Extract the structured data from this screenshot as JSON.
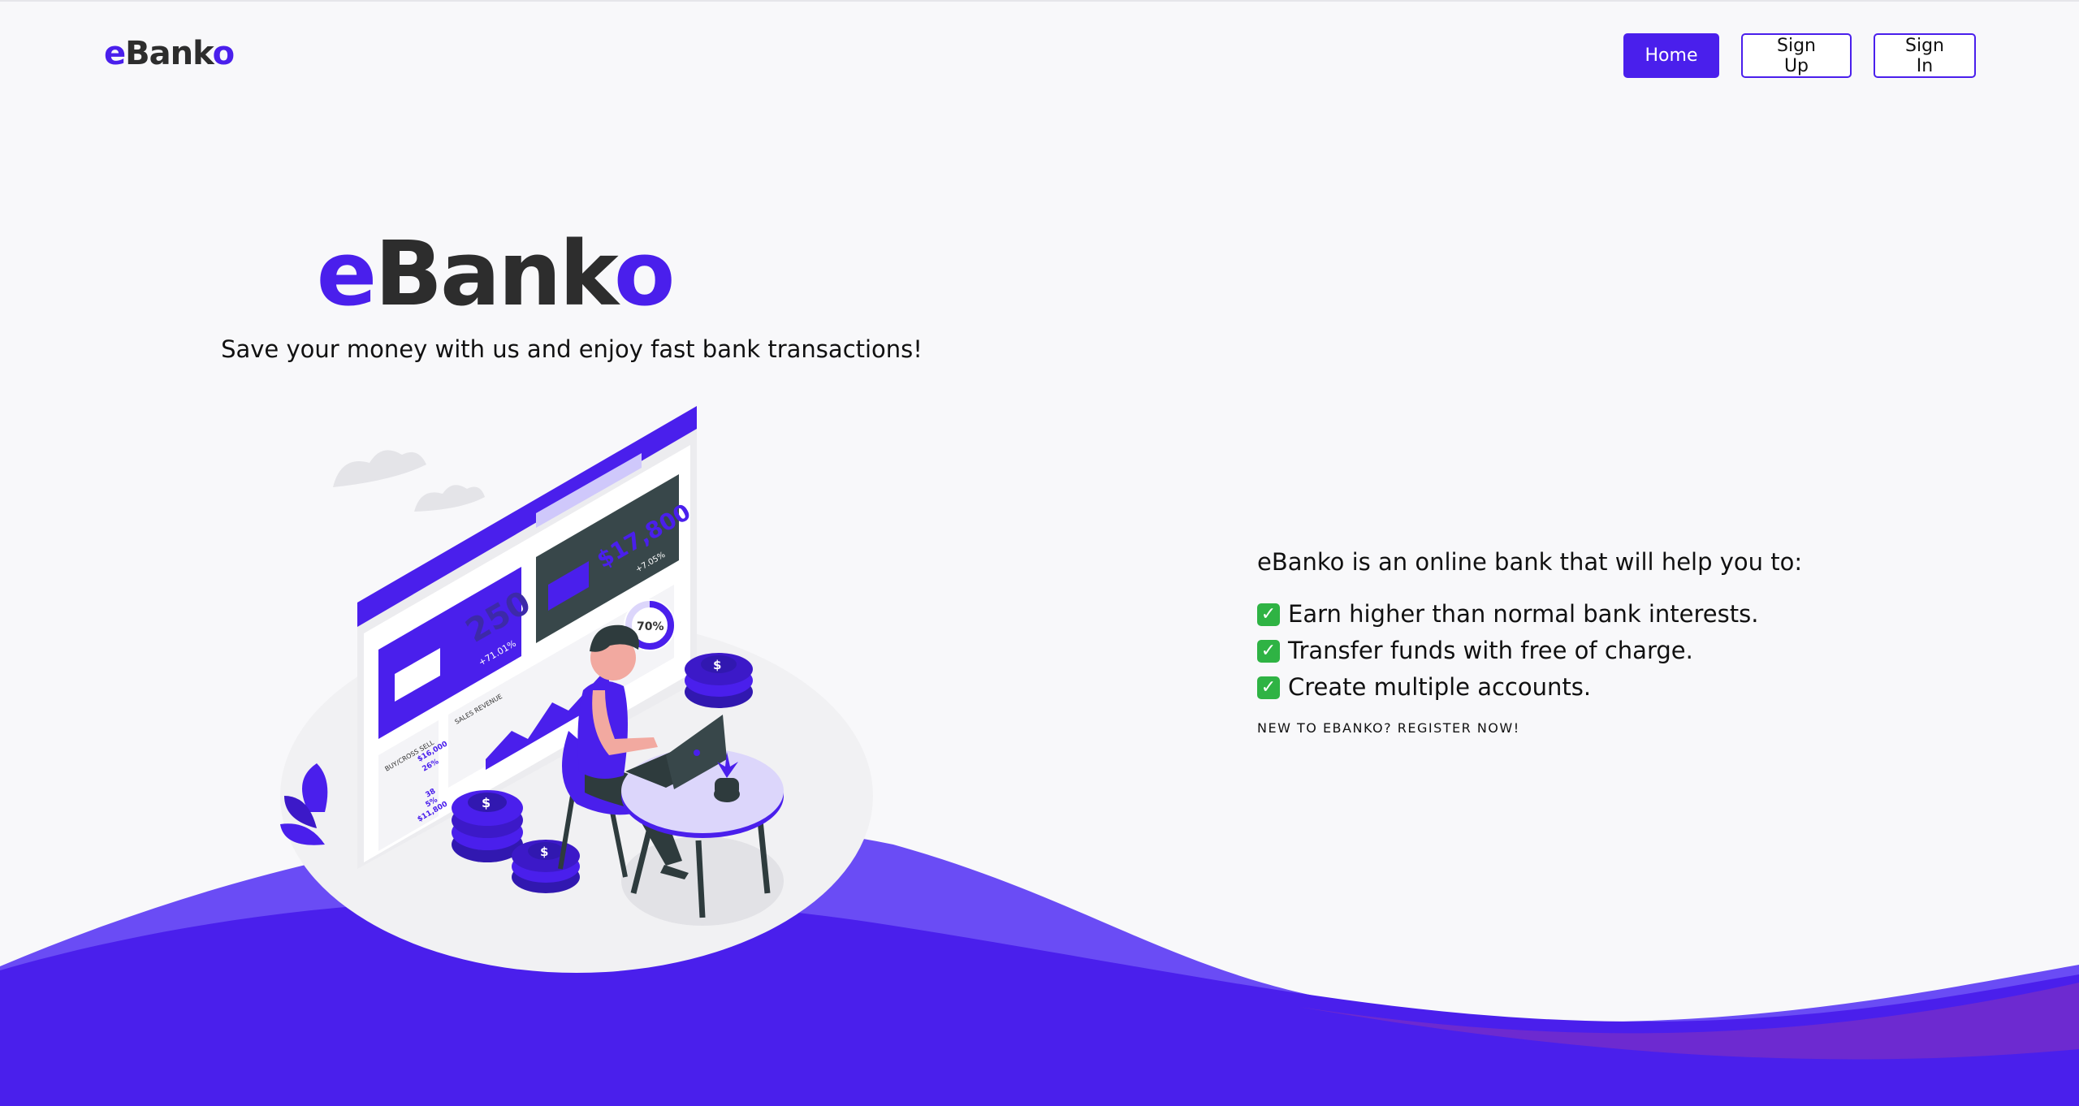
{
  "brand": {
    "prefix": "e",
    "middle": "Bank",
    "suffix": "o"
  },
  "nav": {
    "home_label": "Home",
    "signup_label": "Sign Up",
    "signin_label": "Sign In"
  },
  "hero": {
    "subtitle": "Save your money with us and enjoy fast bank transactions!"
  },
  "illustration": {
    "balance_value": "250",
    "balance_change": "+71.01%",
    "total_value": "$17,800",
    "total_change": "+7.05%",
    "progress_label": "70%",
    "progress": 0.7,
    "sales_label": "SALES REVENUE",
    "buy_sell_label": "BUY/CROSS SELL",
    "stat_value_1": "$16,000",
    "stat_value_2": "26%",
    "stat_value_3": "38",
    "stat_value_4": "5%",
    "stat_value_5": "$11,800",
    "coin_symbol": "$"
  },
  "info": {
    "lead": "eBanko is an online bank that will help you to:",
    "features": [
      "Earn higher than normal bank interests.",
      "Transfer funds with free of charge.",
      "Create multiple accounts."
    ],
    "check_icon": "✓",
    "register_label": "NEW TO EBANKO? REGISTER NOW!"
  },
  "colors": {
    "accent": "#4a1fec",
    "accent_light": "#6a4cf5",
    "dark_text": "#2d2d2d",
    "background": "#f8f8fa",
    "check_green": "#2fb344"
  }
}
